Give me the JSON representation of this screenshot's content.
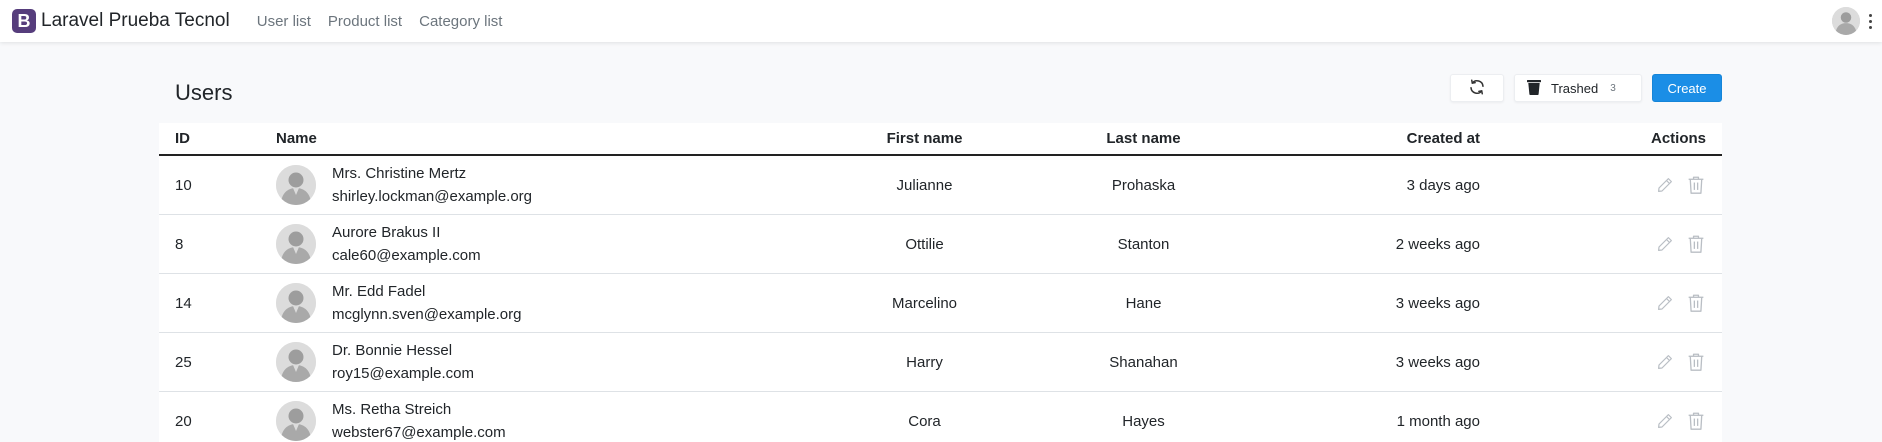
{
  "app": {
    "brand_letter": "B",
    "brand_name": "Laravel Prueba Tecnol",
    "nav": [
      "User list",
      "Product list",
      "Category list"
    ]
  },
  "icons": {
    "brand": "bootstrap-logo-icon",
    "refresh": "refresh-icon",
    "trash": "trash-can-icon",
    "edit": "pencil-icon",
    "delete": "trash-icon",
    "menu": "kebab-menu-icon",
    "avatar": "user-avatar-icon"
  },
  "colors": {
    "brand": "#563d7c",
    "primary": "#1b8ee6",
    "icon_muted": "#b9bec4"
  },
  "page": {
    "title": "Users"
  },
  "toolbar": {
    "trashed_label": "Trashed",
    "trashed_count": "3",
    "create_label": "Create"
  },
  "table": {
    "headers": {
      "id": "ID",
      "name": "Name",
      "first_name": "First name",
      "last_name": "Last name",
      "created_at": "Created at",
      "actions": "Actions"
    },
    "rows": [
      {
        "id": "10",
        "name": "Mrs. Christine Mertz",
        "email": "shirley.lockman@example.org",
        "first_name": "Julianne",
        "last_name": "Prohaska",
        "created_at": "3 days ago"
      },
      {
        "id": "8",
        "name": "Aurore Brakus II",
        "email": "cale60@example.com",
        "first_name": "Ottilie",
        "last_name": "Stanton",
        "created_at": "2 weeks ago"
      },
      {
        "id": "14",
        "name": "Mr. Edd Fadel",
        "email": "mcglynn.sven@example.org",
        "first_name": "Marcelino",
        "last_name": "Hane",
        "created_at": "3 weeks ago"
      },
      {
        "id": "25",
        "name": "Dr. Bonnie Hessel",
        "email": "roy15@example.com",
        "first_name": "Harry",
        "last_name": "Shanahan",
        "created_at": "3 weeks ago"
      },
      {
        "id": "20",
        "name": "Ms. Retha Streich",
        "email": "webster67@example.com",
        "first_name": "Cora",
        "last_name": "Hayes",
        "created_at": "1 month ago"
      }
    ]
  }
}
